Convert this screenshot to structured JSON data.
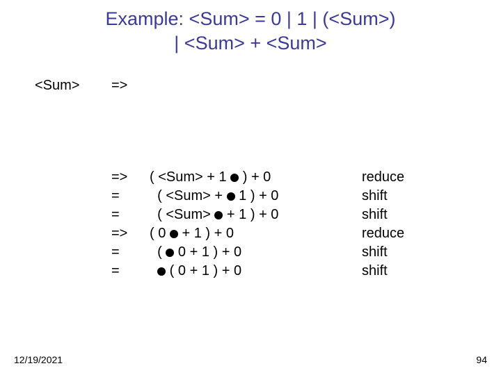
{
  "title_line1": "Example: <Sum> = 0 | 1 | (<Sum>)",
  "title_line2": "| <Sum> + <Sum>",
  "top_row": {
    "lhs": "<Sum>",
    "arrow": "=>",
    "expr": "",
    "action": ""
  },
  "rows": [
    {
      "arrow": "=>",
      "expr_pre": "( <Sum> + 1 ",
      "expr_post": " ) + 0",
      "action": "reduce"
    },
    {
      "arrow": "=",
      "expr_pre": "  ( <Sum> + ",
      "expr_post": " 1 ) + 0",
      "action": "shift"
    },
    {
      "arrow": "=",
      "expr_pre": "  ( <Sum> ",
      "expr_post": " + 1 ) + 0",
      "action": "shift"
    },
    {
      "arrow": "=>",
      "expr_pre": "( 0 ",
      "expr_post": " + 1 ) + 0",
      "action": "reduce"
    },
    {
      "arrow": "=",
      "expr_pre": "  ( ",
      "expr_post": " 0 + 1 ) + 0",
      "action": "shift"
    },
    {
      "arrow": "=",
      "expr_pre": "  ",
      "expr_post": " ( 0 + 1 ) + 0",
      "action": "shift"
    }
  ],
  "footer": {
    "date": "12/19/2021",
    "page": "94"
  }
}
